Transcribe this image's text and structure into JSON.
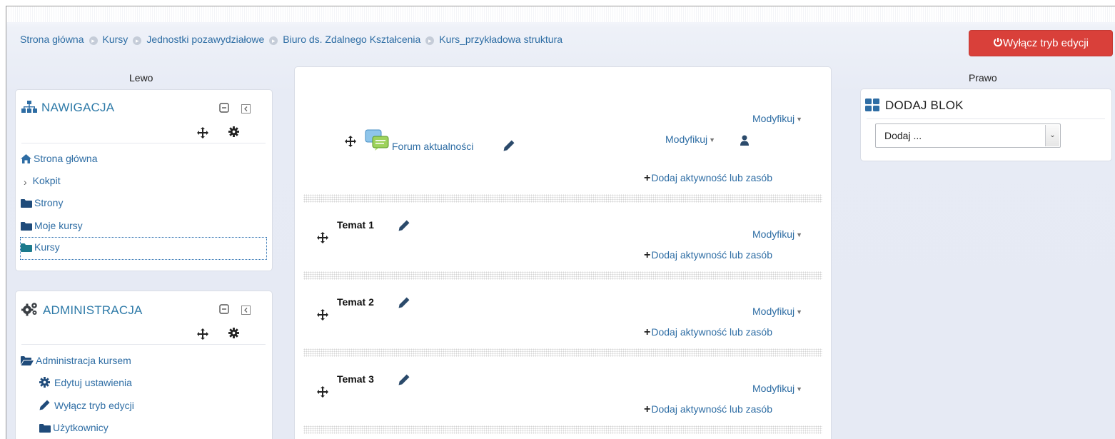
{
  "breadcrumb": {
    "items": [
      "Strona główna",
      "Kursy",
      "Jednostki pozawydziałowe",
      "Biuro ds. Zdalnego Kształcenia",
      "Kurs_przykładowa struktura"
    ]
  },
  "header": {
    "edit_button_label": "Wyłącz tryb edycji"
  },
  "regions": {
    "left_label": "Lewo",
    "right_label": "Prawo"
  },
  "navigation_block": {
    "title": "NAWIGACJA",
    "items": [
      {
        "label": "Strona główna",
        "icon": "home-icon"
      },
      {
        "label": "Kokpit",
        "icon": "chevron-right-icon"
      },
      {
        "label": "Strony",
        "icon": "folder-icon"
      },
      {
        "label": "Moje kursy",
        "icon": "folder-icon"
      },
      {
        "label": "Kursy",
        "icon": "folder-icon"
      }
    ]
  },
  "administration_block": {
    "title": "ADMINISTRACJA",
    "items": [
      {
        "label": "Administracja kursem",
        "icon": "folder-open-icon"
      },
      {
        "label": "Edytuj ustawienia",
        "icon": "gear-icon"
      },
      {
        "label": "Wyłącz tryb edycji",
        "icon": "pencil-icon"
      },
      {
        "label": "Użytkownicy",
        "icon": "folder-icon"
      }
    ]
  },
  "course": {
    "section0": {
      "modify_label": "Modyfikuj",
      "forum": {
        "label": "Forum aktualności",
        "modify_label": "Modyfikuj"
      },
      "add_label": "Dodaj aktywność lub zasób"
    },
    "topics": [
      {
        "title": "Temat 1",
        "modify_label": "Modyfikuj",
        "add_label": "Dodaj aktywność lub zasób"
      },
      {
        "title": "Temat 2",
        "modify_label": "Modyfikuj",
        "add_label": "Dodaj aktywność lub zasób"
      },
      {
        "title": "Temat 3",
        "modify_label": "Modyfikuj",
        "add_label": "Dodaj aktywność lub zasób"
      }
    ]
  },
  "add_block": {
    "title": "DODAJ BLOK",
    "select_value": "Dodaj ..."
  },
  "colors": {
    "link": "#2e6da4",
    "block_title": "#2e7aa8",
    "edit_button": "#d9403a"
  }
}
